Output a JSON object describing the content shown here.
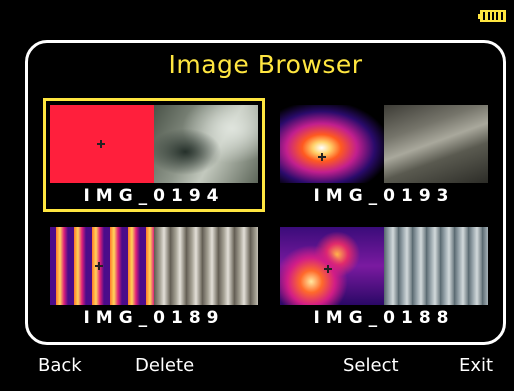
{
  "status": {
    "battery_icon": "battery-icon"
  },
  "header": {
    "title": "Image Browser"
  },
  "images": [
    {
      "name": "IMG_0194",
      "selected": true,
      "thumbnail": "ir-red-and-photo"
    },
    {
      "name": "IMG_0193",
      "selected": false,
      "thumbnail": "ir-pipe-and-photo"
    },
    {
      "name": "IMG_0189",
      "selected": false,
      "thumbnail": "ir-fuses-and-photo"
    },
    {
      "name": "IMG_0188",
      "selected": false,
      "thumbnail": "ir-panel-and-photo"
    }
  ],
  "softkeys": {
    "back": "Back",
    "delete": "Delete",
    "select": "Select",
    "exit": "Exit"
  },
  "colors": {
    "accent": "#ffe640",
    "background": "#000000",
    "text": "#ffffff"
  }
}
